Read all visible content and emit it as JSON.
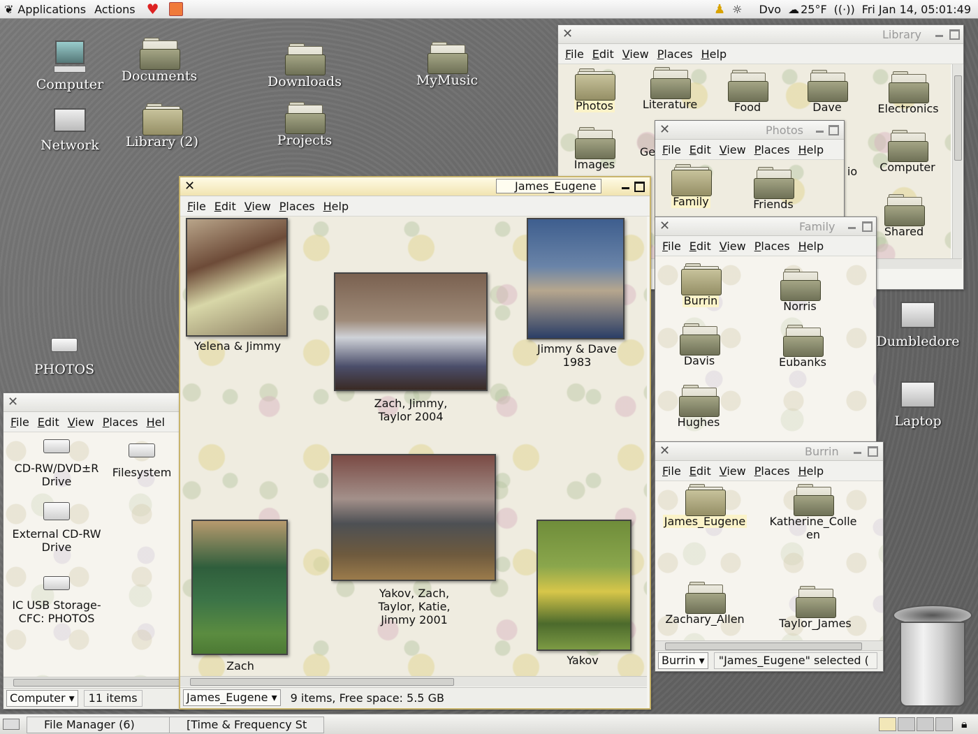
{
  "top_panel": {
    "menu_applications": "Applications",
    "menu_actions": "Actions",
    "location": "Dvo",
    "temperature": "25°F",
    "datetime": "Fri Jan 14, 05:01:49"
  },
  "desktop_icons": {
    "computer": "Computer",
    "documents": "Documents",
    "downloads": "Downloads",
    "mymusic": "MyMusic",
    "network": "Network",
    "library": "Library (2)",
    "projects": "Projects",
    "photos": "PHOTOS",
    "dumbledore": "Dumbledore",
    "laptop": "Laptop"
  },
  "menu": {
    "file": "File",
    "edit": "Edit",
    "view": "View",
    "places": "Places",
    "help": "Help",
    "help_cut": "Hel"
  },
  "library_window": {
    "title": "Library",
    "items": [
      "Photos",
      "Literature",
      "Food",
      "Dave",
      "Electronics",
      "Images",
      "Ge",
      "io",
      "Computer",
      "Shared"
    ]
  },
  "photos_window": {
    "title": "Photos",
    "items": [
      "Family",
      "Friends"
    ]
  },
  "family_window": {
    "title": "Family",
    "items": [
      "Burrin",
      "Norris",
      "Davis",
      "Eubanks",
      "Hughes"
    ]
  },
  "burrin_window": {
    "title": "Burrin",
    "items": [
      "James_Eugene",
      "Katherine_Colleen",
      "Zachary_Allen",
      "Taylor_James"
    ],
    "location_combo": "Burrin",
    "status": "\"James_Eugene\" selected ("
  },
  "james_window": {
    "title": "James_Eugene",
    "photos": {
      "yelena_jimmy": "Yelena & Jimmy",
      "zach_jimmy_taylor": "Zach, Jimmy, Taylor 2004",
      "jimmy_dave": "Jimmy & Dave 1983",
      "yakov_group": "Yakov, Zach, Taylor, Katie, Jimmy 2001",
      "zach": "Zach",
      "yakov": "Yakov"
    },
    "location_combo": "James_Eugene",
    "status": "9 items, Free space: 5.5 GB"
  },
  "computer_window": {
    "items": [
      "CD-RW/DVD±R Drive",
      "Filesystem",
      "External CD-RW Drive",
      "IC USB Storage-CFC: PHOTOS"
    ],
    "location_combo": "Computer",
    "status": "11 items"
  },
  "bottom_panel": {
    "task1": "File Manager (6)",
    "task2": "[Time & Frequency St"
  }
}
